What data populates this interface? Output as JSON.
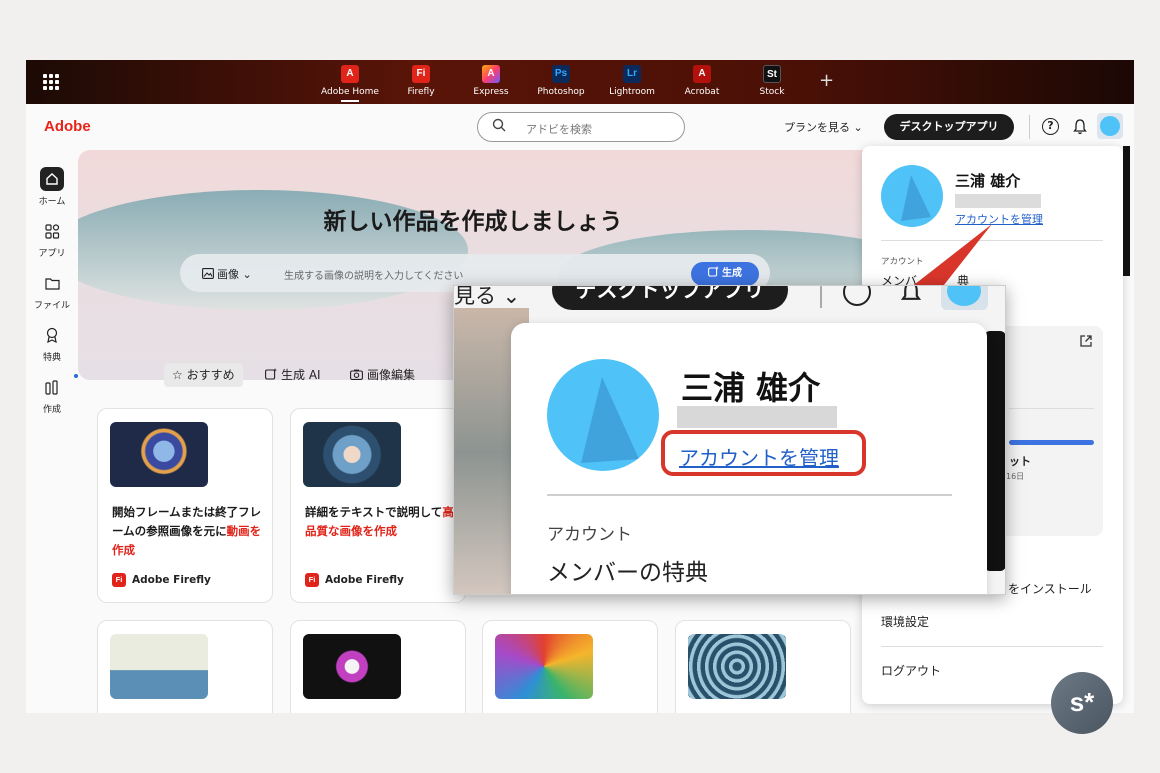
{
  "appbar": {
    "apps": [
      {
        "label": "Adobe Home",
        "glyph": "A",
        "color": "#e0241a"
      },
      {
        "label": "Firefly",
        "glyph": "Fi",
        "color": "#e0241a"
      },
      {
        "label": "Express",
        "glyph": "A",
        "color": "#1a1a2e"
      },
      {
        "label": "Photoshop",
        "glyph": "Ps",
        "color": "#0b2a5a"
      },
      {
        "label": "Lightroom",
        "glyph": "Lr",
        "color": "#0b2a5a"
      },
      {
        "label": "Acrobat",
        "glyph": "A",
        "color": "#b3120c"
      },
      {
        "label": "Stock",
        "glyph": "St",
        "color": "#111111"
      }
    ],
    "plus": "+"
  },
  "header": {
    "logo": "Adobe",
    "search_placeholder": "アドビを検索",
    "plan": "プランを見る ⌄",
    "desktop_app": "デスクトップアプリ",
    "help": "?"
  },
  "nav": [
    {
      "label": "ホーム"
    },
    {
      "label": "アプリ"
    },
    {
      "label": "ファイル"
    },
    {
      "label": "特典"
    },
    {
      "label": "作成"
    }
  ],
  "hero": {
    "title": "新しい作品を作成しましょう",
    "type_select": "画像 ⌄",
    "prompt_placeholder": "生成する画像の説明を入力してください",
    "generate": "生成"
  },
  "chips": [
    {
      "label": "☆ おすすめ"
    },
    {
      "label": "生成 AI"
    },
    {
      "label": "画像編集"
    }
  ],
  "cards": [
    {
      "line1": "開始フレームまたは終了フレームの参照画像を元に",
      "highlight": "動画を作成",
      "brand": "Adobe Firefly"
    },
    {
      "line1": "詳細をテキストで説明して",
      "highlight": "高品質な画像を作成",
      "brand": "Adobe Firefly"
    }
  ],
  "profile": {
    "name": "三浦 雄介",
    "manage_account": "アカウントを管理",
    "section_account": "アカウント",
    "member_benefits": "メンバーの特典",
    "partial_member": "メンバ",
    "partial_benefit": "典",
    "partial_title": "ット",
    "partial_date": "16日",
    "partial_install": "をインストール",
    "settings": "環境設定",
    "logout": "ログアウト"
  },
  "zoom": {
    "plan_partial": "見る ⌄",
    "desktop_app": "デスクトップアプリ",
    "name": "三浦 雄介",
    "manage_account": "アカウントを管理",
    "section_account": "アカウント",
    "member_benefits": "メンバーの特典"
  },
  "badge": "s*"
}
